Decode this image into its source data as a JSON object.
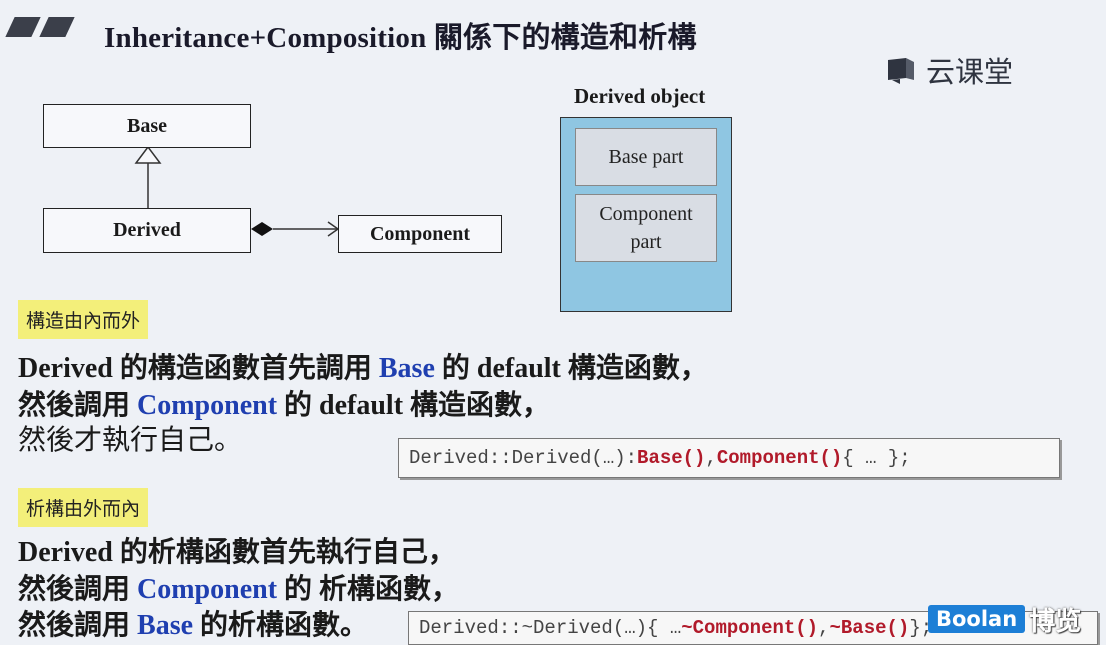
{
  "header": {
    "title": "Inheritance+Composition 關係下的構造和析構"
  },
  "watermark": {
    "name": "云课堂"
  },
  "uml": {
    "base": "Base",
    "derived": "Derived",
    "component": "Component"
  },
  "object": {
    "title": "Derived object",
    "base_part": "Base part",
    "component_part_line1": "Component",
    "component_part_line2": "part"
  },
  "ctor": {
    "tag": "構造由內而外",
    "line1": [
      {
        "t": "Derived",
        "c": "b"
      },
      {
        "t": " 的構造函數首先調用 ",
        "c": "b"
      },
      {
        "t": "Base",
        "c": "kw"
      },
      {
        "t": " 的 default 構造函數，",
        "c": "b"
      }
    ],
    "line2": [
      {
        "t": "然後調用 ",
        "c": "b"
      },
      {
        "t": "Component",
        "c": "kw"
      },
      {
        "t": " 的 default 構造函數，",
        "c": "b"
      }
    ],
    "line3": [
      {
        "t": "然後才執行自己。",
        "c": "plain"
      }
    ],
    "code": [
      {
        "t": "Derived::Derived(…): ",
        "c": "n"
      },
      {
        "t": "Base()",
        "c": "red"
      },
      {
        "t": ",",
        "c": "n"
      },
      {
        "t": "Component()",
        "c": "red"
      },
      {
        "t": " { … };",
        "c": "n"
      }
    ]
  },
  "dtor": {
    "tag": "析構由外而內",
    "line1": [
      {
        "t": "Derived",
        "c": "b"
      },
      {
        "t": " 的析構函數首先執行自己，",
        "c": "b"
      }
    ],
    "line2": [
      {
        "t": "然後調用 ",
        "c": "b"
      },
      {
        "t": "Component",
        "c": "kw"
      },
      {
        "t": " 的 析構函數，",
        "c": "b"
      }
    ],
    "line3": [
      {
        "t": "然後調用 ",
        "c": "b"
      },
      {
        "t": "Base",
        "c": "kw"
      },
      {
        "t": " 的析構函數。",
        "c": "b"
      }
    ],
    "code": [
      {
        "t": "Derived::~Derived(…){ … ",
        "c": "n"
      },
      {
        "t": "~Component()",
        "c": "red"
      },
      {
        "t": ", ",
        "c": "n"
      },
      {
        "t": "~Base()",
        "c": "red"
      },
      {
        "t": " };",
        "c": "n"
      }
    ]
  },
  "logo": {
    "brand": "Boolan",
    "cn": "博览"
  }
}
